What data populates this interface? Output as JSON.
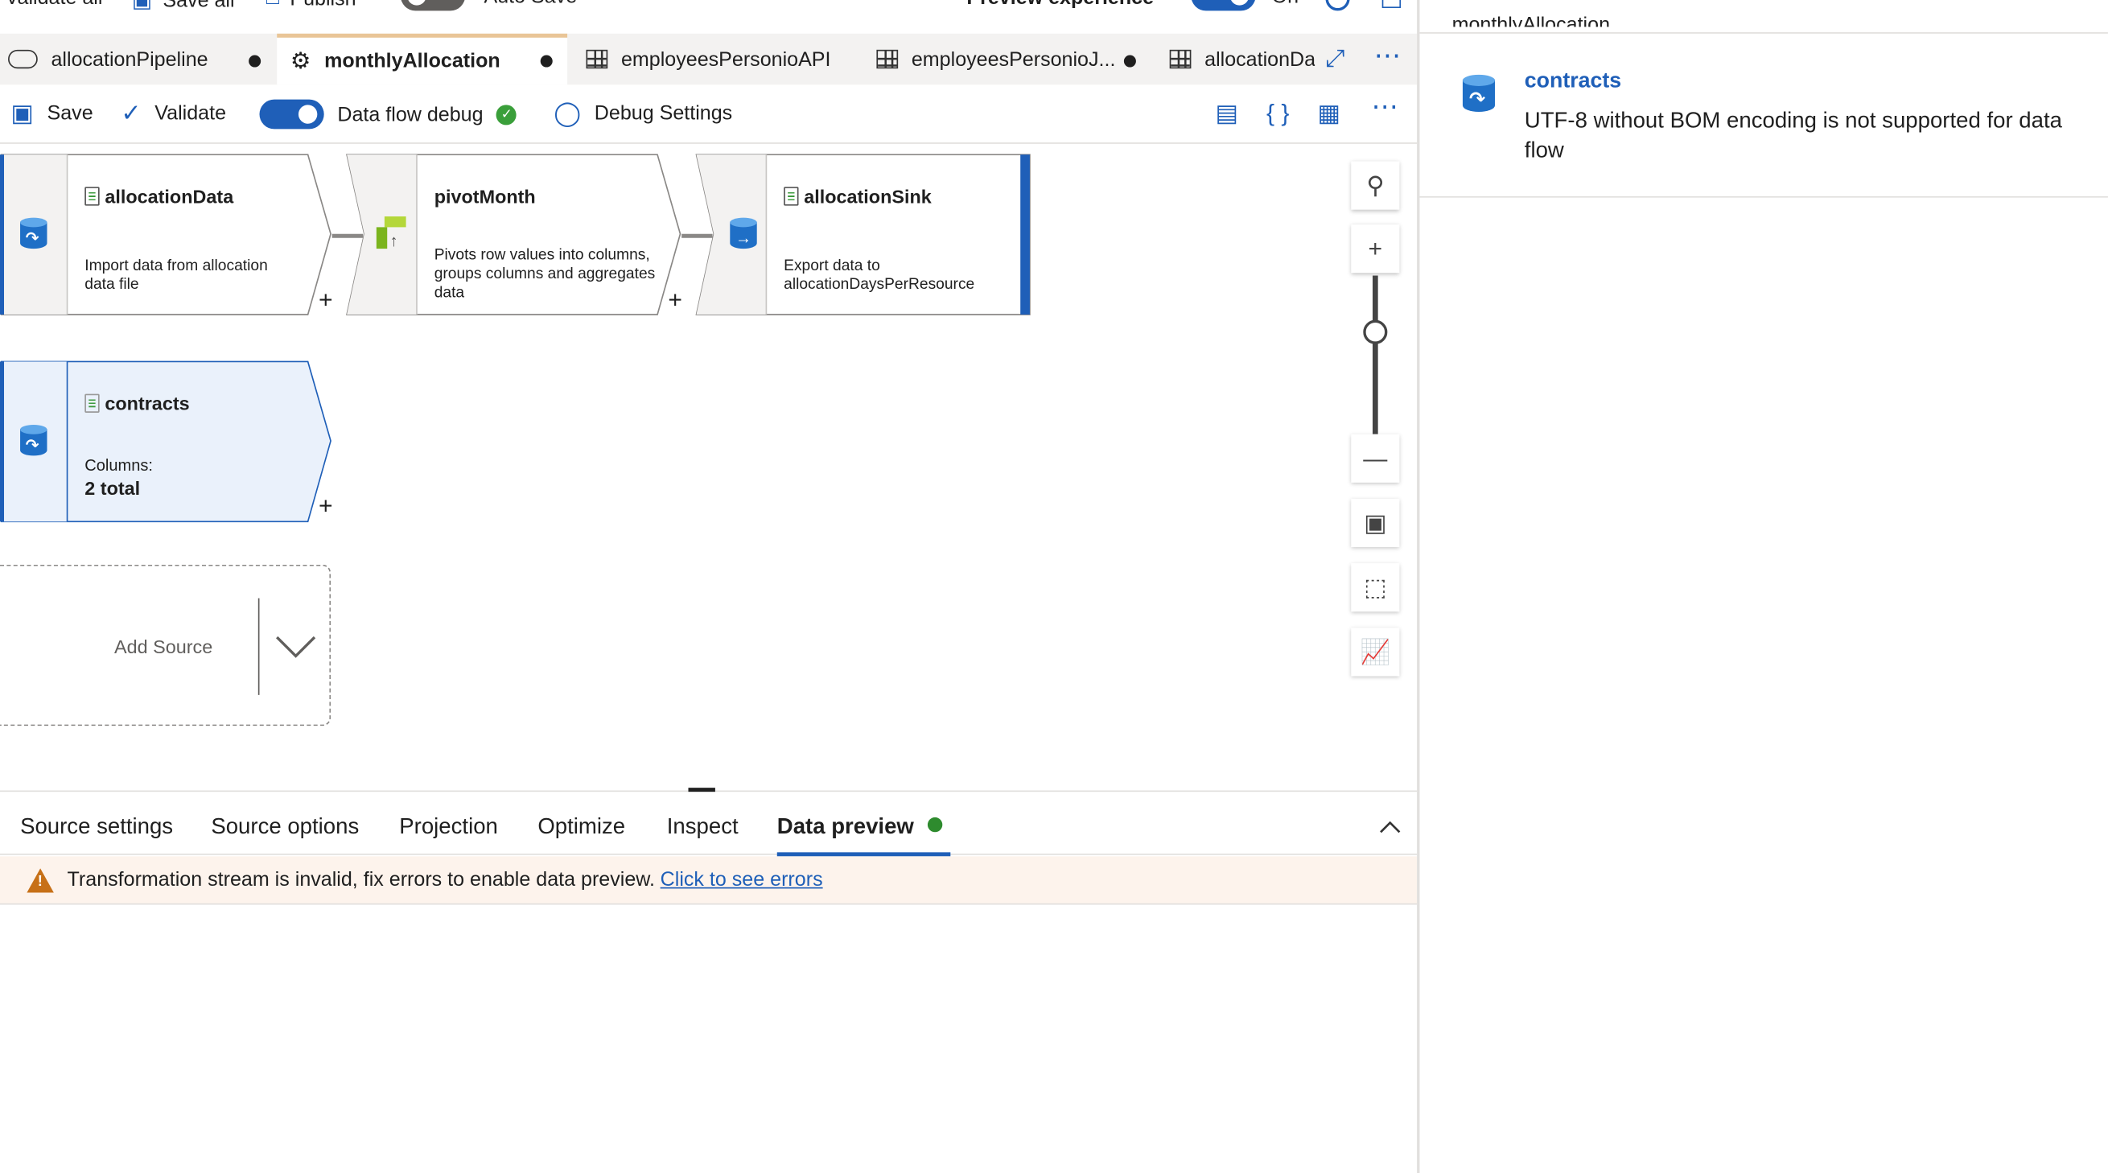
{
  "topbar": {
    "validate_all": "Validate all",
    "save_all": "Save all",
    "publish": "Publish",
    "auto_save": "Auto Save",
    "preview_experience": "Preview experience",
    "preview_state": "On"
  },
  "tabs": [
    {
      "label": "allocationPipeline",
      "icon": "pipeline-icon",
      "unsaved": true
    },
    {
      "label": "monthlyAllocation",
      "icon": "dataflow-icon",
      "unsaved": true,
      "active": true
    },
    {
      "label": "employeesPersonioAPI",
      "icon": "dataset-table-icon",
      "unsaved": false
    },
    {
      "label": "employeesPersonioJ...",
      "icon": "dataset-table-icon",
      "unsaved": true
    },
    {
      "label": "allocationDay",
      "icon": "dataset-table-icon",
      "unsaved": false
    }
  ],
  "toolbar": {
    "save": "Save",
    "validate": "Validate",
    "data_flow_debug": "Data flow debug",
    "debug_settings": "Debug Settings"
  },
  "nodes": {
    "allocationData": {
      "title": "allocationData",
      "desc": "Import data from allocation data file"
    },
    "pivotMonth": {
      "title": "pivotMonth",
      "desc": "Pivots row values into columns, groups columns and aggregates data"
    },
    "allocationSink": {
      "title": "allocationSink",
      "desc": "Export data to allocationDaysPerResource"
    },
    "contracts": {
      "title": "contracts",
      "columns_label": "Columns:",
      "columns_value": "2 total"
    }
  },
  "add_source": "Add Source",
  "bottom_tabs": [
    "Source settings",
    "Source options",
    "Projection",
    "Optimize",
    "Inspect",
    "Data preview"
  ],
  "warning": {
    "text": "Transformation stream is invalid, fix errors to enable data preview.",
    "link": "Click to see errors"
  },
  "error_panel": {
    "header_cut": "monthlyAllocation",
    "entity": "contracts",
    "message": "UTF-8 without BOM encoding is not supported for data flow"
  },
  "colors": {
    "accent": "#1f5fb8",
    "success": "#3a9f3a",
    "warning": "#c77017",
    "active_tab_border": "#e9c597"
  }
}
